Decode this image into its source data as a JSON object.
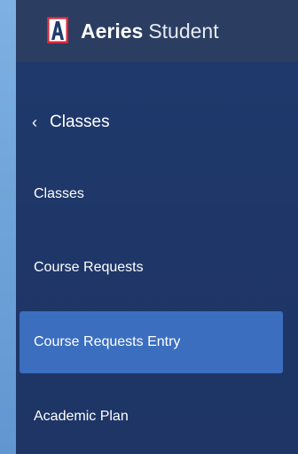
{
  "app": {
    "brand": "Aeries",
    "product": "Student"
  },
  "nav": {
    "back_label": "Classes",
    "items": [
      {
        "label": "Classes",
        "active": false
      },
      {
        "label": "Course Requests",
        "active": false
      },
      {
        "label": "Course Requests Entry",
        "active": true
      },
      {
        "label": "Academic Plan",
        "active": false
      }
    ]
  },
  "colors": {
    "header_bg": "#2b3d61",
    "sidebar_bg": "#1f3768",
    "active_item_bg": "#3b6ebf",
    "logo_red": "#d9263a",
    "page_bg": "#6ea3d9"
  }
}
